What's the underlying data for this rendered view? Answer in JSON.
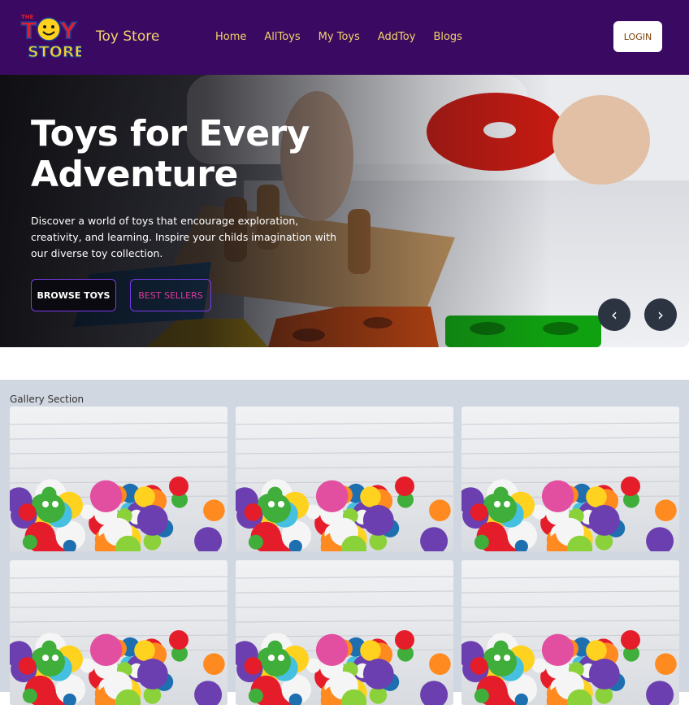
{
  "header": {
    "logo": {
      "top_text": "THE",
      "line1": "TOY",
      "line2": "STORE",
      "icon": "smiley-face-icon"
    },
    "brand": "Toy Store",
    "nav": [
      "Home",
      "AllToys",
      "My Toys",
      "AddToy",
      "Blogs"
    ],
    "login_label": "LOGIN"
  },
  "hero": {
    "title": "Toys for Every Adventure",
    "description": "Discover a world of toys that encourage exploration, creativity, and learning. Inspire your childs imagination with our diverse toy collection.",
    "browse_label": "BROWSE TOYS",
    "best_label": "BEST SELLERS",
    "prev_icon": "chevron-left-icon",
    "next_icon": "chevron-right-icon",
    "prev_glyph": "‹",
    "next_glyph": "›"
  },
  "gallery": {
    "title": "Gallery Section",
    "items": [
      {
        "image": "plush-toys-photo"
      },
      {
        "image": "plush-toys-photo"
      },
      {
        "image": "plush-toys-photo"
      },
      {
        "image": "plush-toys-photo"
      },
      {
        "image": "plush-toys-photo"
      },
      {
        "image": "plush-toys-photo"
      }
    ]
  },
  "colors": {
    "navbar": "#3a0a62",
    "nav_text": "#f2d36b",
    "accent_purple": "#7c3aed",
    "best_text": "#e0389a",
    "gallery_bg": "#d1d7e1"
  }
}
